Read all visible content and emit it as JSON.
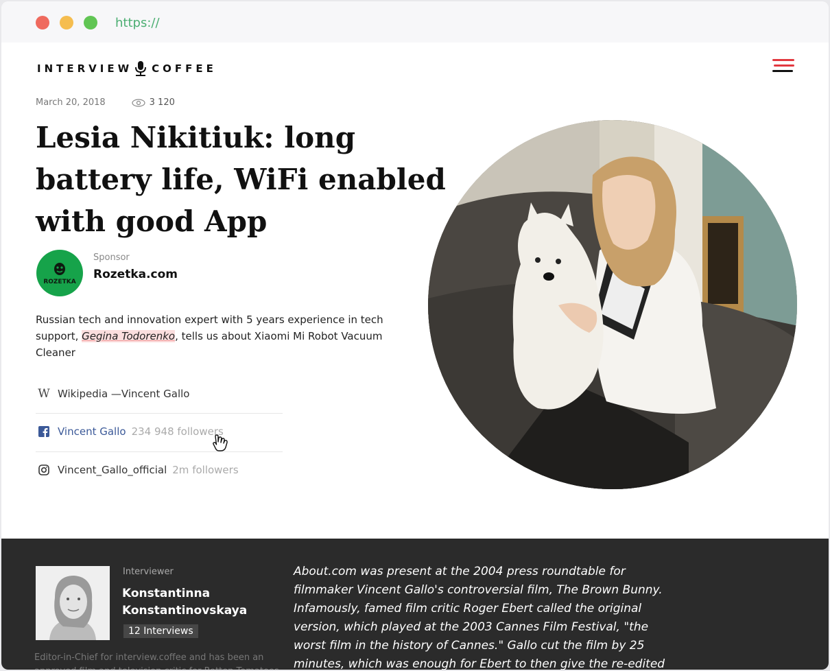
{
  "browser": {
    "url": "https://"
  },
  "site": {
    "logo_left": "INTERVIEW",
    "logo_right": "COFFEE",
    "menu_icon": "hamburger-menu-icon",
    "accent": "#e2383f"
  },
  "article": {
    "date": "March 20, 2018",
    "views": "3 120",
    "title": "Lesia Nikitiuk: long battery life, WiFi enabled with good App",
    "sponsor_label": "Sponsor",
    "sponsor_name": "Rozetka.com",
    "sponsor_logo_text": "ROZETKA",
    "description_before": "Russian tech and innovation expert with 5 years experience in tech support, ",
    "description_highlight": "Gegina Todorenko",
    "description_after": ", tells us about Xiaomi Mi Robot Vacuum Cleaner"
  },
  "links": [
    {
      "icon": "wikipedia-icon",
      "label": "Wikipedia —Vincent Gallo",
      "followers": ""
    },
    {
      "icon": "facebook-icon",
      "label": "Vincent Gallo",
      "followers": "234 948 followers"
    },
    {
      "icon": "instagram-icon",
      "label": "Vincent_Gallo_official",
      "followers": "2m followers"
    }
  ],
  "interviewer": {
    "label": "Interviewer",
    "name": "Konstantinna Konstantinovskaya",
    "interviews": "12 Interviews",
    "bio": "Editor-in-Chief for interview.coffee and has been an approved film and television critic for Rotten Tomatoes"
  },
  "quote": "About.com was present at the 2004 press roundtable for filmmaker Vincent Gallo's controversial film, The Brown Bunny. Infamously, famed film critic Roger Ebert called the original version, which played at the 2003 Cannes Film Festival, \"the worst film in the history of Cannes.\" Gallo cut the film by 25 minutes, which was enough for Ebert to then give the re-edited"
}
